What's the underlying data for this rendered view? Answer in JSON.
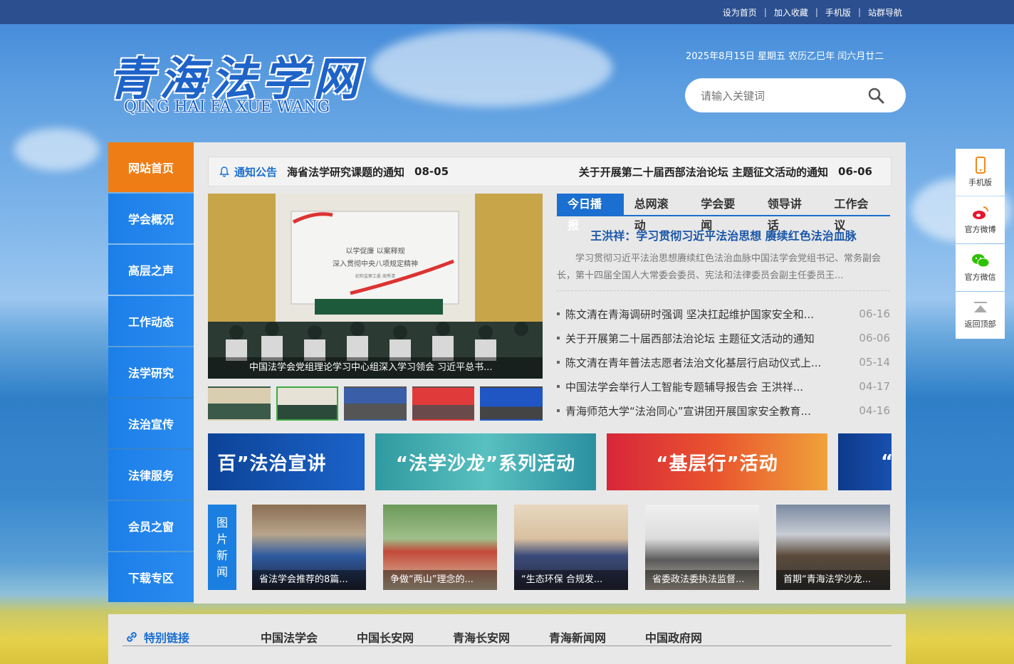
{
  "topbar": {
    "links": [
      "设为首页",
      "加入收藏",
      "手机版",
      "站群导航"
    ]
  },
  "logo": {
    "cn": "青海法学网",
    "en": "QING HAI FA XUE WANG"
  },
  "date": "2025年8月15日 星期五 农历乙巳年 闰六月廿二",
  "search": {
    "placeholder": "请输入关键词"
  },
  "nav": [
    "网站首页",
    "学会概况",
    "高层之声",
    "工作动态",
    "法学研究",
    "法治宣传",
    "法律服务",
    "会员之窗",
    "下载专区"
  ],
  "notice": {
    "label": "通知公告",
    "items": [
      {
        "title": "海省法学研究课题的通知",
        "date": "08-05"
      },
      {
        "title": "关于开展第二十届西部法治论坛 主题征文活动的通知",
        "date": "06-06"
      }
    ]
  },
  "slide": {
    "caption": "中国法学会党组理论学习中心组深入学习领会 习近平总书...",
    "screen_line1": "以学促廉 以案释规",
    "screen_line2": "深入贯彻中央八项规定精神",
    "screen_line3": "纪检监察工委 周秀清"
  },
  "tabs": [
    "今日播报",
    "总网滚动",
    "学会要闻",
    "领导讲话",
    "工作会议"
  ],
  "headline": "王洪祥：学习贯彻习近平法治思想 赓续红色法治血脉",
  "summary": "学习贯彻习近平法治思想赓续红色法治血脉中国法学会党组书记、常务副会长，第十四届全国人大常委会委员、宪法和法律委员会副主任委员王...",
  "news": [
    {
      "title": "陈文清在青海调研时强调 坚决扛起维护国家安全和...",
      "date": "06-16"
    },
    {
      "title": "关于开展第二十届西部法治论坛 主题征文活动的通知",
      "date": "06-06"
    },
    {
      "title": "陈文清在青年普法志愿者法治文化基层行启动仪式上...",
      "date": "05-14"
    },
    {
      "title": "中国法学会举行人工智能专题辅导报告会 王洪祥...",
      "date": "04-17"
    },
    {
      "title": "青海师范大学“法治同心”宣讲团开展国家安全教育...",
      "date": "04-16"
    }
  ],
  "banners": [
    "百”法治宣讲",
    "“法学沙龙”系列活动",
    "“基层行”活动",
    "“"
  ],
  "picnews": {
    "label": [
      "图",
      "片",
      "新",
      "闻"
    ],
    "items": [
      "省法学会推荐的8篇...",
      "争做“两山”理念的...",
      "“生态环保 合规发...",
      "省委政法委执法监督...",
      "首期“青海法学沙龙..."
    ]
  },
  "links": {
    "label": "特别链接",
    "items": [
      "中国法学会",
      "中国长安网",
      "青海长安网",
      "青海新闻网",
      "中国政府网"
    ]
  },
  "side": [
    "手机版",
    "官方微博",
    "官方微信",
    "返回顶部"
  ]
}
